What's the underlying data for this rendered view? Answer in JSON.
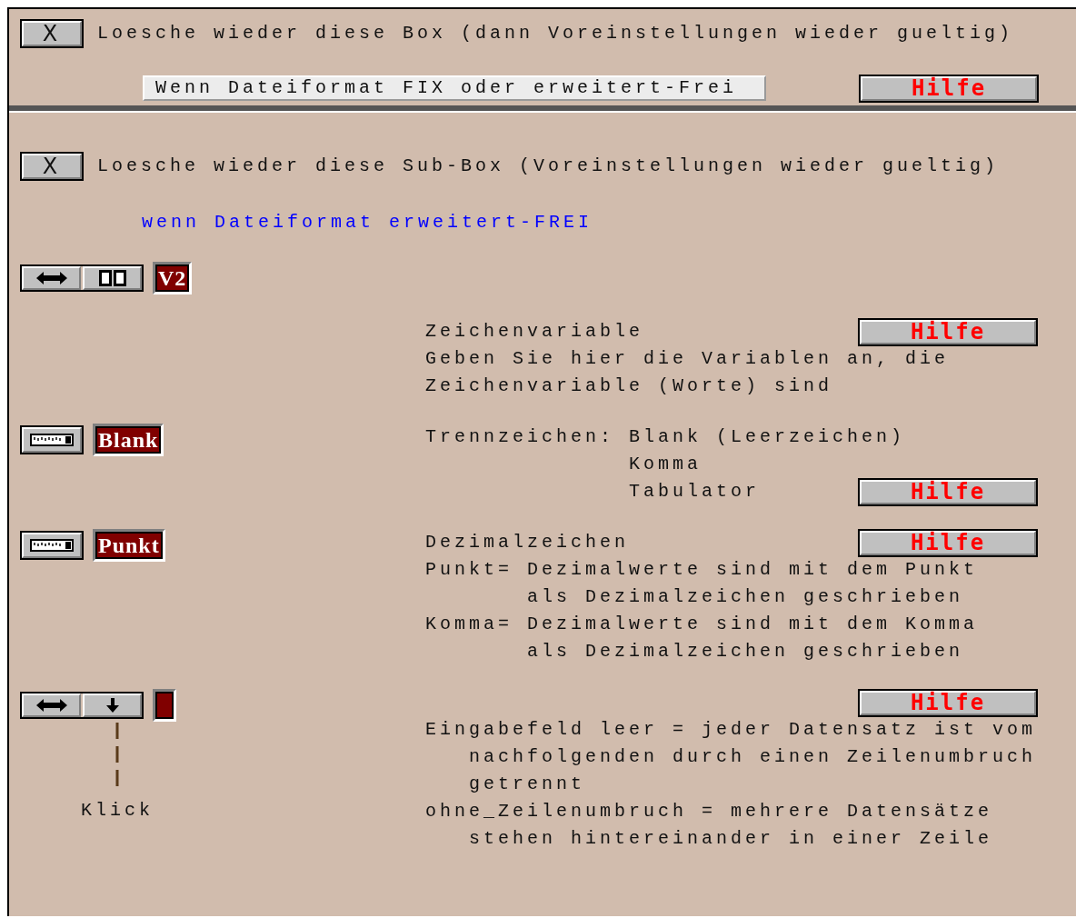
{
  "box": {
    "close_label": "X",
    "title": "Loesche wieder diese Box (dann Voreinstellungen wieder gueltig)",
    "condition": "Wenn Dateiformat FIX oder erweitert-Frei",
    "help": "Hilfe"
  },
  "sub_box": {
    "close_label": "X",
    "title": "Loesche wieder diese Sub-Box (Voreinstellungen wieder gueltig)",
    "condition": "wenn Dateiformat erweitert-FREI",
    "items": [
      {
        "control": {
          "kind": "toggle",
          "buttons": [
            {
              "kind": "swap"
            },
            {
              "kind": "columns"
            }
          ],
          "value": "V2"
        }
      },
      {
        "rows": [
          {
            "text": "Zeichenvariable",
            "help": "Hilfe"
          },
          {
            "text": "Geben Sie hier die Variablen an, die"
          },
          {
            "text": "Zeichenvariable (Worte) sind"
          }
        ]
      },
      {
        "control": {
          "kind": "list",
          "value": "Blank"
        },
        "rows": [
          {
            "text": "Trennzeichen: Blank (Leerzeichen)"
          },
          {
            "text": "              Komma"
          },
          {
            "text": "              Tabulator",
            "help": "Hilfe"
          }
        ]
      },
      {
        "control": {
          "kind": "list",
          "value": "Punkt"
        },
        "rows": [
          {
            "text": "Dezimalzeichen",
            "help": "Hilfe"
          },
          {
            "text": "Punkt= Dezimalwerte sind mit dem Punkt"
          },
          {
            "text": "       als Dezimalzeichen geschrieben"
          },
          {
            "text": "Komma= Dezimalwerte sind mit dem Komma"
          },
          {
            "text": "       als Dezimalzeichen geschrieben"
          }
        ]
      },
      {
        "control": {
          "kind": "toggle",
          "buttons": [
            {
              "kind": "swap"
            },
            {
              "kind": "down"
            }
          ],
          "note": "Klick"
        },
        "rows": [
          {
            "help": "Hilfe"
          },
          {
            "text": "Eingabefeld leer = jeder Datensatz ist vom"
          },
          {
            "text": "   nachfolgenden durch einen Zeilenumbruch"
          },
          {
            "text": "   getrennt"
          },
          {
            "text": "ohne_Zeilenumbruch = mehrere Datensätze"
          },
          {
            "text": "   stehen hintereinander in einer Zeile"
          }
        ]
      }
    ]
  }
}
